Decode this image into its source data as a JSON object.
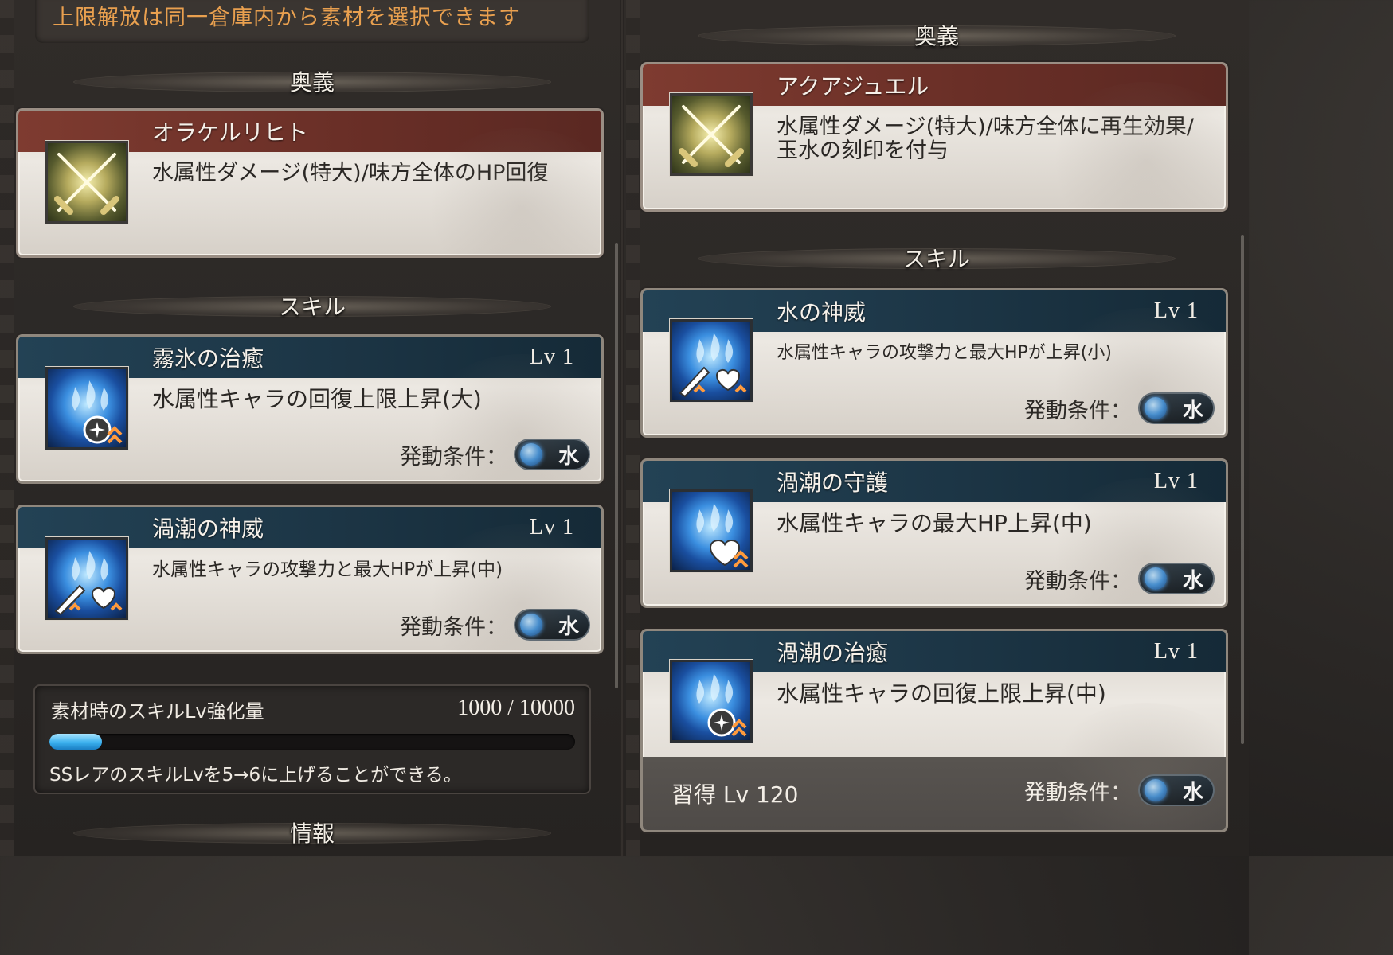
{
  "notice": {
    "text": "上限解放は同一倉庫内から素材を選択できます"
  },
  "left": {
    "ougi_header": "奥義",
    "ougi": {
      "name": "オラケルリヒト",
      "desc": "水属性ダメージ(特大)/味方全体のHP回復"
    },
    "skill_header": "スキル",
    "skills": [
      {
        "name": "霧氷の治癒",
        "lv": "Lv 1",
        "desc": "水属性キャラの回復上限上昇(大)",
        "cond_label": "発動条件：",
        "element": "水"
      },
      {
        "name": "渦潮の神威",
        "lv": "Lv 1",
        "desc": "水属性キャラの攻撃力と最大HPが上昇(中)",
        "cond_label": "発動条件：",
        "element": "水"
      }
    ],
    "material": {
      "label": "素材時のスキルLv強化量",
      "value": "1000 / 10000",
      "current": 1000,
      "max": 10000,
      "note": "SSレアのスキルLvを5→6に上げることができる。"
    },
    "info_header": "情報"
  },
  "right": {
    "ougi_header": "奥義",
    "ougi": {
      "name": "アクアジュエル",
      "desc": "水属性ダメージ(特大)/味方全体に再生効果/玉水の刻印を付与"
    },
    "skill_header": "スキル",
    "skills": [
      {
        "name": "水の神威",
        "lv": "Lv 1",
        "desc": "水属性キャラの攻撃力と最大HPが上昇(小)",
        "cond_label": "発動条件：",
        "element": "水"
      },
      {
        "name": "渦潮の守護",
        "lv": "Lv 1",
        "desc": "水属性キャラの最大HP上昇(中)",
        "cond_label": "発動条件：",
        "element": "水"
      },
      {
        "name": "渦潮の治癒",
        "lv": "Lv 1",
        "desc": "水属性キャラの回復上限上昇(中)",
        "cond_label": "発動条件：",
        "element": "水",
        "acquire": "習得 Lv 120"
      }
    ]
  },
  "icons": {
    "ougi": "crossed-swords-icon",
    "skill_heal": "water-heal-up-icon",
    "skill_atk_hp": "water-attack-hp-up-icon",
    "skill_hp": "water-hp-up-icon",
    "element": "water-element-icon"
  },
  "colors": {
    "notice_text": "#e9a04f",
    "ougi_band": "#7e3b30",
    "skill_band": "#234255",
    "gauge": "#3ab0ee"
  }
}
